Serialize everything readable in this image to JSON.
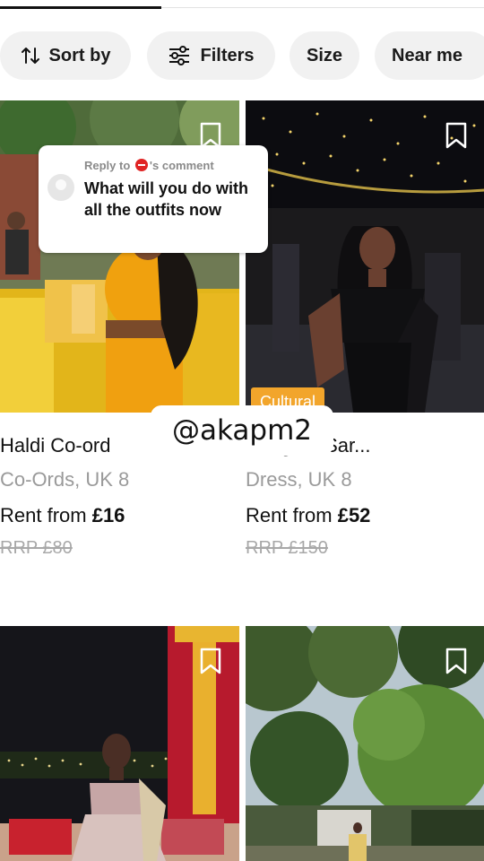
{
  "filters": [
    {
      "label": "Sort by",
      "icon": "sort-arrows-icon"
    },
    {
      "label": "Filters",
      "icon": "sliders-icon"
    },
    {
      "label": "Size"
    },
    {
      "label": "Near me"
    }
  ],
  "products": [
    {
      "title": "Haldi Co-ord",
      "meta": "Co-Ords, UK 8",
      "price_prefix": "Rent from ",
      "price": "£16",
      "rrp": "RRP £80",
      "badge": ""
    },
    {
      "title": "Sangeet Sar...",
      "meta": "Dress, UK 8",
      "price_prefix": "Rent from ",
      "price": "£52",
      "rrp": "RRP £150",
      "badge": "Cultural"
    },
    {
      "title": "",
      "meta": "",
      "price_prefix": "",
      "price": "",
      "rrp": ""
    },
    {
      "title": "",
      "meta": "",
      "price_prefix": "",
      "price": "",
      "rrp": ""
    }
  ],
  "reply_overlay": {
    "meta_prefix": "Reply to",
    "meta_suffix": "'s comment",
    "text": "What will you do with all the outfits now"
  },
  "watermark": "@akapm2",
  "colors": {
    "badge": "#f2a52b",
    "chip_bg": "#f1f1f1",
    "muted_text": "#9a9a9a"
  }
}
